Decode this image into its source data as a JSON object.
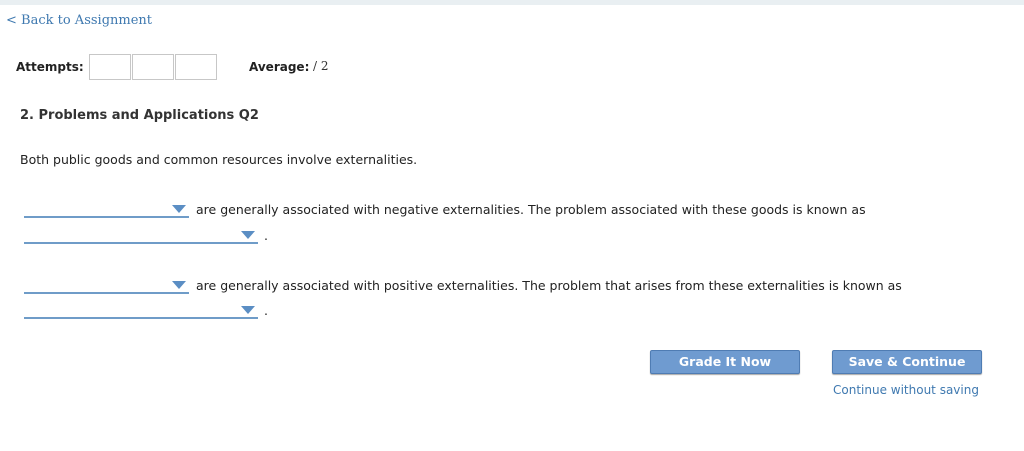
{
  "nav": {
    "back_label": "< Back to Assignment"
  },
  "attempts": {
    "label": "Attempts:",
    "average_label": "Average:",
    "average_value": "/ 2"
  },
  "question": {
    "title": "2. Problems and Applications Q2",
    "intro": "Both public goods and common resources involve externalities.",
    "sentence1_text": "are generally associated with negative externalities. The problem associated with these goods is known as",
    "sentence2_text": "are generally associated with positive externalities. The problem that arises from these externalities is known as",
    "period": "."
  },
  "buttons": {
    "grade_label": "Grade It Now",
    "save_label": "Save & Continue",
    "continue_without_saving": "Continue without saving"
  },
  "colors": {
    "link": "#3f79b0",
    "button": "#6f9bd0",
    "dropdown_line": "#6f9cc8"
  },
  "icons": {
    "dropdown_caret": "chevron-down-icon"
  }
}
